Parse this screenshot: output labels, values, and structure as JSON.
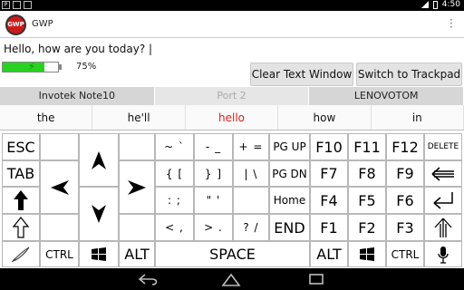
{
  "status": {
    "time": "4:50"
  },
  "app": {
    "title": "GWP",
    "logo_text": "GWP"
  },
  "text_window": {
    "value": "Hello, how are you today? |"
  },
  "battery": {
    "percent_label": "75%",
    "level": 0.75
  },
  "buttons": {
    "clear": "Clear Text Window",
    "trackpad": "Switch to Trackpad"
  },
  "devices": [
    "Invotek Note10",
    "Port 2",
    "LENOVOTOM"
  ],
  "suggestions": [
    "the",
    "he'll",
    "hello",
    "how",
    "in"
  ],
  "keys": {
    "esc": "ESC",
    "tab": "TAB",
    "tilde": "~ `",
    "minus": "- _",
    "plus": "+ =",
    "brace": "{ [",
    "brace_close": "} ]",
    "pipe": "| \\",
    "colon": ": ;",
    "quote": "\" '",
    "lt": "< ,",
    "gt": "> .",
    "question": "? /",
    "pgup": "PG UP",
    "pgdn": "PG DN",
    "home": "Home",
    "end": "END",
    "f1": "F1",
    "f2": "F2",
    "f3": "F3",
    "f4": "F4",
    "f5": "F5",
    "f6": "F6",
    "f7": "F7",
    "f8": "F8",
    "f9": "F9",
    "f10": "F10",
    "f11": "F11",
    "f12": "F12",
    "delete": "DELETE",
    "ctrl_left": "CTRL",
    "alt_left": "ALT",
    "space": "SPACE",
    "alt_right": "ALT",
    "ctrl_right": "CTRL"
  }
}
